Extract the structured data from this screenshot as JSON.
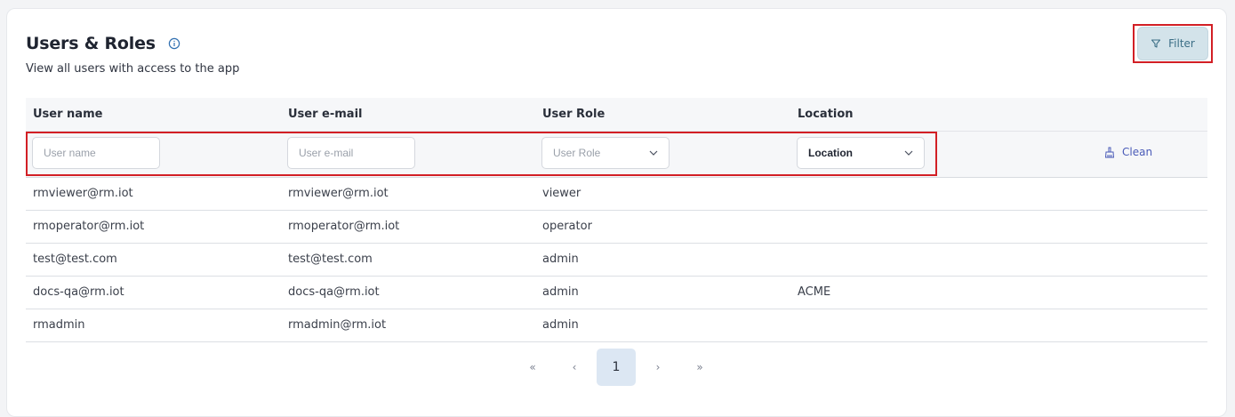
{
  "header": {
    "title": "Users & Roles",
    "subtitle": "View all users with access to the app",
    "filter_label": "Filter"
  },
  "table": {
    "columns": [
      "User name",
      "User e-mail",
      "User Role",
      "Location"
    ],
    "filters": {
      "user_name_placeholder": "User name",
      "user_email_placeholder": "User e-mail",
      "user_role_placeholder": "User Role",
      "location_value": "Location",
      "clean_label": "Clean"
    },
    "rows": [
      [
        "rmviewer@rm.iot",
        "rmviewer@rm.iot",
        "viewer",
        ""
      ],
      [
        "rmoperator@rm.iot",
        "rmoperator@rm.iot",
        "operator",
        ""
      ],
      [
        "test@test.com",
        "test@test.com",
        "admin",
        ""
      ],
      [
        "docs-qa@rm.iot",
        "docs-qa@rm.iot",
        "admin",
        "ACME"
      ],
      [
        "rmadmin",
        "rmadmin@rm.iot",
        "admin",
        ""
      ]
    ]
  },
  "pagination": {
    "first": "«",
    "prev": "‹",
    "current_page": "1",
    "next": "›",
    "last": "»"
  }
}
